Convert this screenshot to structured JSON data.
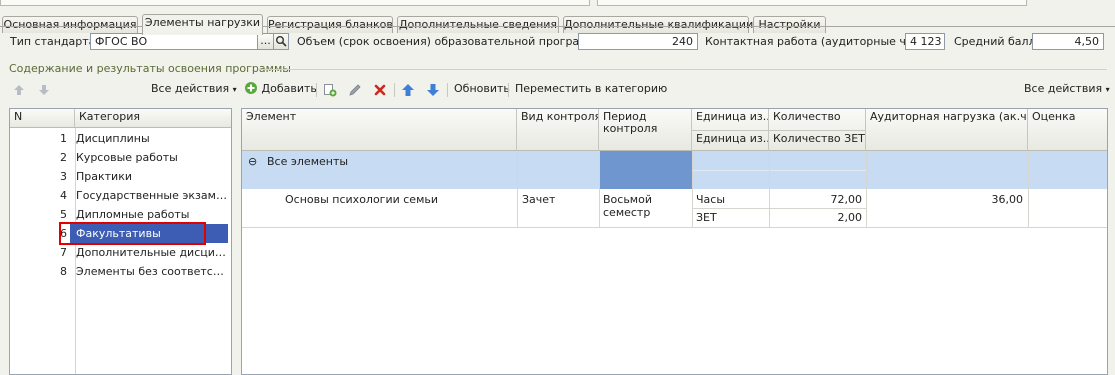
{
  "tabs": [
    {
      "label": "Основная информация",
      "active": false
    },
    {
      "label": "Элементы нагрузки",
      "active": true
    },
    {
      "label": "Регистрация бланков",
      "active": false
    },
    {
      "label": "Дополнительные сведения",
      "active": false
    },
    {
      "label": "Дополнительные квалификации",
      "active": false
    },
    {
      "label": "Настройки",
      "active": false
    }
  ],
  "form": {
    "standard_label": "Тип стандарта:",
    "standard_value": "ФГОС ВО",
    "select_button": "...",
    "volume_label": "Объем (срок освоения) образовательной программы:",
    "volume_value": "240",
    "contact_label": "Контактная работа (аудиторные часы):",
    "contact_value": "4 123",
    "avg_label": "Средний балл:",
    "avg_value": "4,50"
  },
  "section_title": "Содержание и результаты освоения программы",
  "left_toolbar": {
    "all_actions": "Все действия"
  },
  "toolbar": {
    "add": "Добавить",
    "refresh": "Обновить",
    "move": "Переместить в категорию",
    "all_actions": "Все действия"
  },
  "categories": {
    "headers": {
      "n": "N",
      "category": "Категория"
    },
    "rows": [
      {
        "n": "1",
        "name": "Дисциплины"
      },
      {
        "n": "2",
        "name": "Курсовые работы"
      },
      {
        "n": "3",
        "name": "Практики"
      },
      {
        "n": "4",
        "name": "Государственные экзамены"
      },
      {
        "n": "5",
        "name": "Дипломные работы"
      },
      {
        "n": "6",
        "name": "Факультативы"
      },
      {
        "n": "7",
        "name": "Дополнительные дисципли..."
      },
      {
        "n": "8",
        "name": "Элементы без соответствий"
      }
    ],
    "selected_index": 5
  },
  "elements": {
    "headers": {
      "element": "Элемент",
      "control": "Вид контроля",
      "period": "Период контроля",
      "unit": "Единица из...",
      "unit_sub": "Единица из...",
      "qty": "Количество",
      "qty_sub": "Количество ЗЕТ",
      "load": "Аудиторная нагрузка (ак.час.)",
      "grade": "Оценка"
    },
    "group_label": "Все элементы",
    "row": {
      "element": "Основы психологии семьи",
      "control": "Зачет",
      "period_line1": "Восьмой",
      "period_line2": "семестр",
      "unit1": "Часы",
      "unit2": "ЗЕТ",
      "qty1": "72,00",
      "qty2": "2,00",
      "load": "36,00",
      "grade": ""
    }
  },
  "colors": {
    "selection": "#3d5db4",
    "group_row": "#c7dbf3",
    "period_cell": "#6f96cf",
    "highlight_box": "#e00000"
  }
}
